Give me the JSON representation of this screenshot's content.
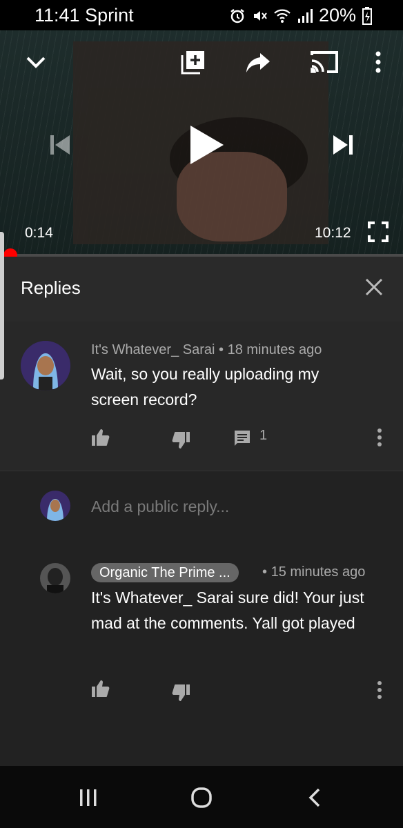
{
  "status_bar": {
    "time": "11:41",
    "carrier": "Sprint",
    "battery": "20%"
  },
  "player": {
    "current_time": "0:14",
    "duration": "10:12",
    "progress_fraction": 0.023
  },
  "replies_panel": {
    "title": "Replies"
  },
  "comment": {
    "author": "It's Whatever_ Sarai",
    "separator": "•",
    "time_ago": "18 minutes ago",
    "text": "Wait, so you really uploading my screen record?",
    "reply_count": "1"
  },
  "reply_input": {
    "placeholder": "Add a public reply..."
  },
  "reply": {
    "author": "Organic The Prime ...",
    "separator": "•",
    "time_ago": "15 minutes ago",
    "text": "It's Whatever_ Sarai sure did! Your just mad at the comments. Yall got played"
  },
  "colors": {
    "progress_red": "#ff0000",
    "panel_bg": "#212121"
  }
}
